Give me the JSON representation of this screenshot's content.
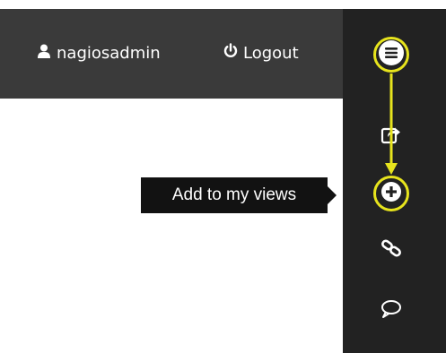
{
  "header": {
    "username": "nagiosadmin",
    "logout_label": "Logout",
    "user_icon": "user-icon",
    "logout_icon": "power-icon"
  },
  "sidebar": {
    "items": [
      {
        "name": "menu",
        "icon": "hamburger-menu-icon",
        "highlighted": true
      },
      {
        "name": "share",
        "icon": "share-icon",
        "highlighted": false
      },
      {
        "name": "add-to-my-views",
        "icon": "plus-circle-icon",
        "highlighted": true
      },
      {
        "name": "link",
        "icon": "link-icon",
        "highlighted": false
      },
      {
        "name": "comment",
        "icon": "comment-icon",
        "highlighted": false
      }
    ]
  },
  "tooltip": {
    "text": "Add to my views"
  },
  "colors": {
    "topbar": "#3a3a3a",
    "sidebar": "#222222",
    "highlight": "#e7e41d",
    "tooltip_bg": "#121212",
    "text": "#ffffff"
  }
}
